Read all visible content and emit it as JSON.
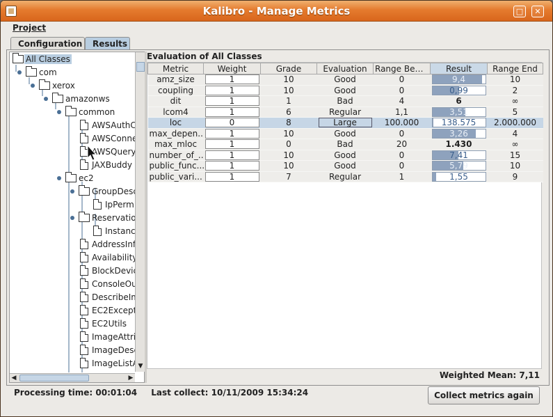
{
  "window": {
    "title": "Kalibro - Manage Metrics",
    "controls": {
      "maximize": "□",
      "close": "✕"
    }
  },
  "menu": {
    "project": "Project"
  },
  "tabs": [
    {
      "label": "Configuration",
      "active": false
    },
    {
      "label": "Results",
      "active": true
    }
  ],
  "tree": [
    {
      "label": "All Classes",
      "kind": "folder",
      "level": 0,
      "selected": true
    },
    {
      "label": "com",
      "kind": "folder",
      "level": 1
    },
    {
      "label": "xerox",
      "kind": "folder",
      "level": 2
    },
    {
      "label": "amazonws",
      "kind": "folder",
      "level": 3
    },
    {
      "label": "common",
      "kind": "folder",
      "level": 4
    },
    {
      "label": "AWSAuthCo",
      "kind": "doc",
      "level": 5
    },
    {
      "label": "AWSConnec",
      "kind": "doc",
      "level": 5
    },
    {
      "label": "AWSQueryC",
      "kind": "doc",
      "level": 5
    },
    {
      "label": "JAXBuddy",
      "kind": "doc",
      "level": 5
    },
    {
      "label": "ec2",
      "kind": "folder",
      "level": 4
    },
    {
      "label": "GroupDesc",
      "kind": "folder",
      "level": 5
    },
    {
      "label": "IpPerm",
      "kind": "doc",
      "level": 6
    },
    {
      "label": "Reservation",
      "kind": "folder",
      "level": 5
    },
    {
      "label": "Instanc",
      "kind": "doc",
      "level": 6
    },
    {
      "label": "AddressInf",
      "kind": "doc",
      "level": 5
    },
    {
      "label": "Availability",
      "kind": "doc",
      "level": 5
    },
    {
      "label": "BlockDevic",
      "kind": "doc",
      "level": 5
    },
    {
      "label": "ConsoleOut",
      "kind": "doc",
      "level": 5
    },
    {
      "label": "DescribeIm",
      "kind": "doc",
      "level": 5
    },
    {
      "label": "EC2Except",
      "kind": "doc",
      "level": 5
    },
    {
      "label": "EC2Utils",
      "kind": "doc",
      "level": 5
    },
    {
      "label": "ImageAttrib",
      "kind": "doc",
      "level": 5
    },
    {
      "label": "ImageDesc",
      "kind": "doc",
      "level": 5
    },
    {
      "label": "ImageListA",
      "kind": "doc",
      "level": 5
    }
  ],
  "evaluation": {
    "title": "Evaluation of All Classes",
    "columns": [
      "Metric",
      "Weight",
      "Grade",
      "Evaluation",
      "Range Begin...",
      "Result",
      "Range End"
    ],
    "rows": [
      {
        "metric": "amz_size",
        "weight": "1",
        "grade": "10",
        "evaluation": "Good",
        "range_begin": "0",
        "result": "9,4",
        "result_fraction": 0.94,
        "range_end": "10"
      },
      {
        "metric": "coupling",
        "weight": "1",
        "grade": "10",
        "evaluation": "Good",
        "range_begin": "0",
        "result": "0,99",
        "result_fraction": 0.495,
        "range_end": "2"
      },
      {
        "metric": "dit",
        "weight": "1",
        "grade": "1",
        "evaluation": "Bad",
        "range_begin": "4",
        "result": "6",
        "result_style": "bold",
        "range_end": "∞"
      },
      {
        "metric": "lcom4",
        "weight": "1",
        "grade": "6",
        "evaluation": "Regular",
        "range_begin": "1,1",
        "result": "3,51",
        "result_fraction": 0.62,
        "range_end": "5"
      },
      {
        "metric": "loc",
        "weight": "0",
        "grade": "8",
        "evaluation": "Large",
        "range_begin": "100.000",
        "result": "138.575",
        "result_fraction": 0.02,
        "range_end": "2.000.000",
        "selected": true
      },
      {
        "metric": "max_depen...",
        "weight": "1",
        "grade": "10",
        "evaluation": "Good",
        "range_begin": "0",
        "result": "3,26",
        "result_fraction": 0.815,
        "range_end": "4"
      },
      {
        "metric": "max_mloc",
        "weight": "1",
        "grade": "0",
        "evaluation": "Bad",
        "range_begin": "20",
        "result": "1.430",
        "result_style": "bold",
        "range_end": "∞"
      },
      {
        "metric": "number_of_...",
        "weight": "1",
        "grade": "10",
        "evaluation": "Good",
        "range_begin": "0",
        "result": "7,41",
        "result_fraction": 0.494,
        "range_end": "15"
      },
      {
        "metric": "public_func...",
        "weight": "1",
        "grade": "10",
        "evaluation": "Good",
        "range_begin": "0",
        "result": "5,79",
        "result_fraction": 0.579,
        "range_end": "10"
      },
      {
        "metric": "public_vari...",
        "weight": "1",
        "grade": "7",
        "evaluation": "Regular",
        "range_begin": "1",
        "result": "1,55",
        "result_fraction": 0.07,
        "range_end": "9"
      }
    ]
  },
  "weighted_mean": "Weighted Mean: 7,11",
  "status": {
    "processing": "Processing time: 00:01:04",
    "last_collect": "Last collect: 10/11/2009 15:34:24"
  },
  "buttons": {
    "collect": "Collect metrics again"
  },
  "colors": {
    "titlebar": "#e57b2e",
    "selection": "#c6d6e6",
    "result_bar": "#8ea2bd"
  }
}
